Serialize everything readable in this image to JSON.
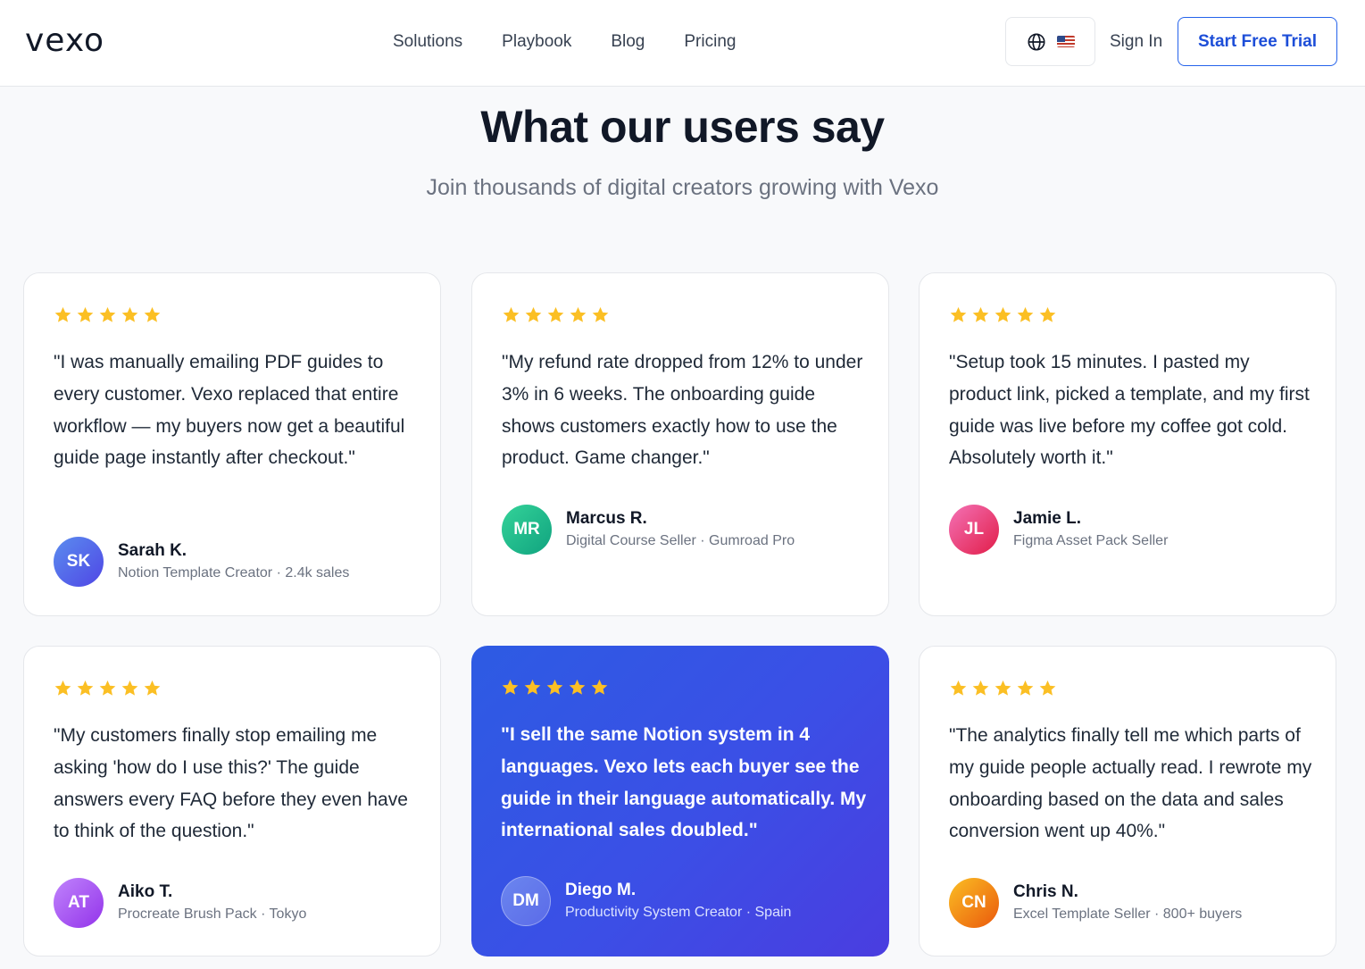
{
  "header": {
    "logo_text": "vexo",
    "nav": [
      "Solutions",
      "Playbook",
      "Blog",
      "Pricing"
    ],
    "signin_label": "Sign In",
    "trial_label": "Start Free Trial",
    "lang_icon": "globe-icon",
    "flag_icon": "us-flag-icon"
  },
  "section": {
    "title": "What our users say",
    "subtitle": "Join thousands of digital creators growing with Vexo"
  },
  "testimonials": [
    {
      "rating": 5,
      "quote": "\"I was manually emailing PDF guides to every customer. Vexo replaced that entire workflow — my buyers now get a beautiful guide page instantly after checkout.\"",
      "initials": "SK",
      "name": "Sarah K.",
      "role": "Notion Template Creator · 2.4k sales",
      "avatar_gradient": [
        "#5b8def",
        "#4f46e5"
      ]
    },
    {
      "rating": 5,
      "quote": "\"My refund rate dropped from 12% to under 3% in 6 weeks. The onboarding guide shows customers exactly how to use the product. Game changer.\"",
      "initials": "MR",
      "name": "Marcus R.",
      "role": "Digital Course Seller · Gumroad Pro",
      "avatar_gradient": [
        "#34d399",
        "#10a37f"
      ]
    },
    {
      "rating": 5,
      "quote": "\"Setup took 15 minutes. I pasted my product link, picked a template, and my first guide was live before my coffee got cold. Absolutely worth it.\"",
      "initials": "JL",
      "name": "Jamie L.",
      "role": "Figma Asset Pack Seller",
      "avatar_gradient": [
        "#f472b6",
        "#e11d48"
      ]
    },
    {
      "rating": 5,
      "quote": "\"My customers finally stop emailing me asking 'how do I use this?' The guide answers every FAQ before they even have to think of the question.\"",
      "initials": "AT",
      "name": "Aiko T.",
      "role": "Procreate Brush Pack · Tokyo",
      "avatar_gradient": [
        "#c084fc",
        "#9333ea"
      ]
    },
    {
      "rating": 5,
      "quote": "\"I sell the same Notion system in 4 languages. Vexo lets each buyer see the guide in their language automatically. My international sales doubled.\"",
      "initials": "DM",
      "name": "Diego M.",
      "role": "Productivity System Creator · Spain",
      "avatar_gradient": [
        "#6b86ef",
        "#5b6be8"
      ]
    },
    {
      "rating": 5,
      "quote": "\"The analytics finally tell me which parts of my guide people actually read. I rewrote my onboarding based on the data and sales conversion went up 40%.\"",
      "initials": "CN",
      "name": "Chris N.",
      "role": "Excel Template Seller · 800+ buyers",
      "avatar_gradient": [
        "#fbbf24",
        "#ea580c"
      ]
    }
  ],
  "colors": {
    "accent": "#2563eb",
    "star": "#fbbf24",
    "featured_card": "#3b4fe6"
  }
}
